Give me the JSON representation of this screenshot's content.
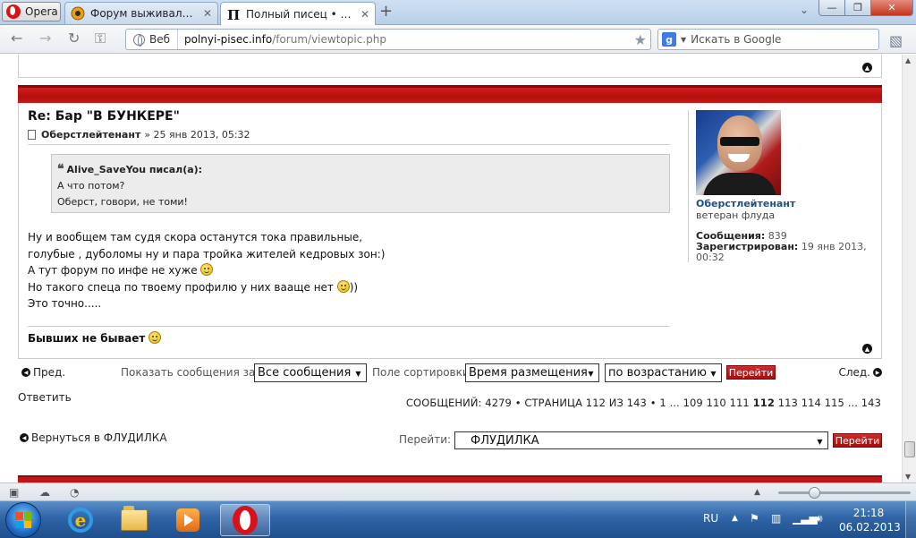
{
  "browser": {
    "menu_label": "Opera",
    "tabs": [
      {
        "title": "Форум выживальщик...",
        "close": "✕",
        "active": false
      },
      {
        "title": "Полный писец • Прос...",
        "close": "✕",
        "active": true
      }
    ],
    "new_tab": "+",
    "address": {
      "chip": "Веб",
      "host": "polnyi-pisec.info",
      "path": "/forum/viewtopic.php"
    },
    "search": {
      "engine": "g",
      "placeholder": "Искать в Google"
    },
    "window_controls": {
      "minimize": "—",
      "maximize": "❐",
      "close": "✕"
    }
  },
  "post": {
    "title": "Re: Бар \"В БУНКЕРЕ\"",
    "author": "Оберстлейтенант",
    "date": "» 25 янв 2013, 05:32",
    "quote": {
      "header": "Alive_SaveYou писал(а):",
      "lines": [
        "А что потом?",
        "Оберст, говори, не томи!"
      ]
    },
    "body_lines": [
      "Ну и вообщем там судя скора останутся тока правильные,",
      "голубые , дуболомы ну и пара тройка жителей кедровых зон:)",
      "А тут форум по инфе не хуже",
      "Но такого спеца по твоему профилю у них вааще нет",
      "))",
      "Это точно....."
    ],
    "signature": "Бывших не бывает"
  },
  "profile": {
    "name": "Оберстлейтенант",
    "rank": "ветеран флуда",
    "messages_label": "Сообщения:",
    "messages_value": "839",
    "registered_label": "Зарегистрирован:",
    "registered_value": "19 янв 2013,",
    "registered_time": "00:32"
  },
  "navigation": {
    "prev": "Пред.",
    "next": "След.",
    "show_label": "Показать сообщения за:",
    "show_value": "Все сообщения",
    "sort_label": "Поле сортировки",
    "sort_value": "Время размещения",
    "order_value": "по возрастанию",
    "go_button": "Перейти"
  },
  "reply_label": "Ответить",
  "pagination": {
    "summary": "СООБЩЕНИЙ: 4279 • СТРАНИЦА 112 ИЗ 143 •",
    "pages_before": "1 ... 109 110 111",
    "current": "112",
    "pages_after": "113 114 115 ... 143"
  },
  "back_link": "Вернуться в ФЛУДИЛКА",
  "jump": {
    "label": "Перейти:",
    "value": "ФЛУДИЛКА",
    "button": "Перейти"
  },
  "taskbar": {
    "lang": "RU",
    "time": "21:18",
    "date": "06.02.2013"
  }
}
